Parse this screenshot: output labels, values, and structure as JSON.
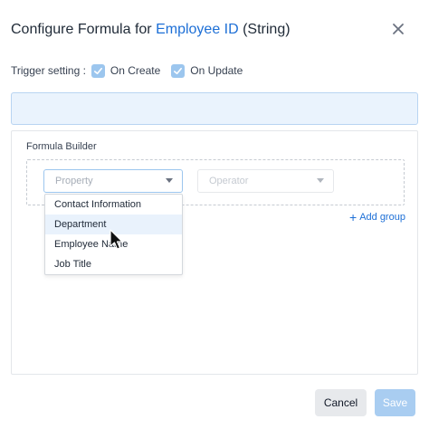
{
  "header": {
    "title_prefix": "Configure Formula for ",
    "field_name": "Employee ID",
    "field_type": " (String)",
    "close_icon": "close-icon"
  },
  "trigger": {
    "label": "Trigger setting :",
    "on_create": {
      "label": "On Create",
      "checked": true
    },
    "on_update": {
      "label": "On Update",
      "checked": true
    }
  },
  "formula_input": {
    "value": ""
  },
  "builder": {
    "title": "Formula Builder",
    "property_select": {
      "placeholder": "Property"
    },
    "operator_select": {
      "placeholder": "Operator"
    },
    "add_group_label": "Add group"
  },
  "dropdown": {
    "options": [
      "Contact Information",
      "Department",
      "Employee Name",
      "Job Title"
    ],
    "hovered_index": 1
  },
  "footer": {
    "cancel_label": "Cancel",
    "save_label": "Save"
  },
  "colors": {
    "accent": "#1d6fd6",
    "checkbox": "#9cc6ee",
    "formula_bg": "#eaf3fd",
    "save_disabled": "#a9cdf1"
  }
}
